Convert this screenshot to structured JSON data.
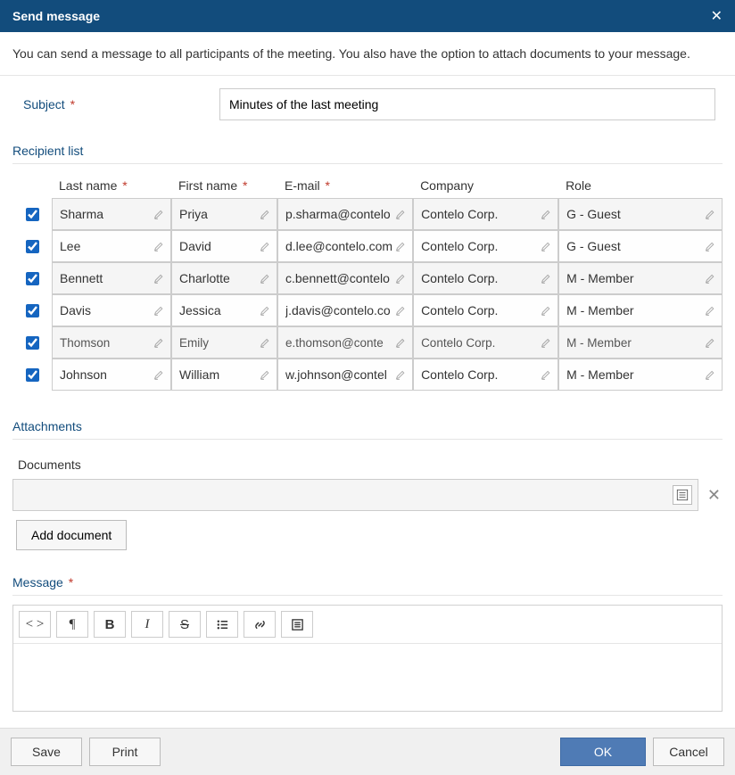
{
  "dialog": {
    "title": "Send message",
    "info": "You can send a message to all participants of the meeting. You also have the option to attach documents to your message."
  },
  "subject": {
    "label": "Subject",
    "value": "Minutes of the last meeting"
  },
  "recipientList": {
    "title": "Recipient list",
    "headers": {
      "lastName": "Last name",
      "firstName": "First name",
      "email": "E-mail",
      "company": "Company",
      "role": "Role"
    },
    "rows": [
      {
        "checked": true,
        "lastName": "Sharma",
        "firstName": "Priya",
        "email": "p.sharma@contelo",
        "company": "Contelo Corp.",
        "role": "G - Guest",
        "small": false
      },
      {
        "checked": true,
        "lastName": "Lee",
        "firstName": "David",
        "email": "d.lee@contelo.com",
        "company": "Contelo Corp.",
        "role": "G - Guest",
        "small": false
      },
      {
        "checked": true,
        "lastName": "Bennett",
        "firstName": "Charlotte",
        "email": "c.bennett@contelo",
        "company": "Contelo Corp.",
        "role": "M - Member",
        "small": false
      },
      {
        "checked": true,
        "lastName": "Davis",
        "firstName": "Jessica",
        "email": "j.davis@contelo.co",
        "company": "Contelo Corp.",
        "role": "M - Member",
        "small": false
      },
      {
        "checked": true,
        "lastName": "Thomson",
        "firstName": "Emily",
        "email": "e.thomson@conte",
        "company": "Contelo Corp.",
        "role": "M - Member",
        "small": true
      },
      {
        "checked": true,
        "lastName": "Johnson",
        "firstName": "William",
        "email": "w.johnson@contel",
        "company": "Contelo Corp.",
        "role": "M - Member",
        "small": false
      }
    ]
  },
  "attachments": {
    "title": "Attachments",
    "documentsLabel": "Documents",
    "addButton": "Add document"
  },
  "message": {
    "label": "Message"
  },
  "footer": {
    "save": "Save",
    "print": "Print",
    "ok": "OK",
    "cancel": "Cancel"
  }
}
